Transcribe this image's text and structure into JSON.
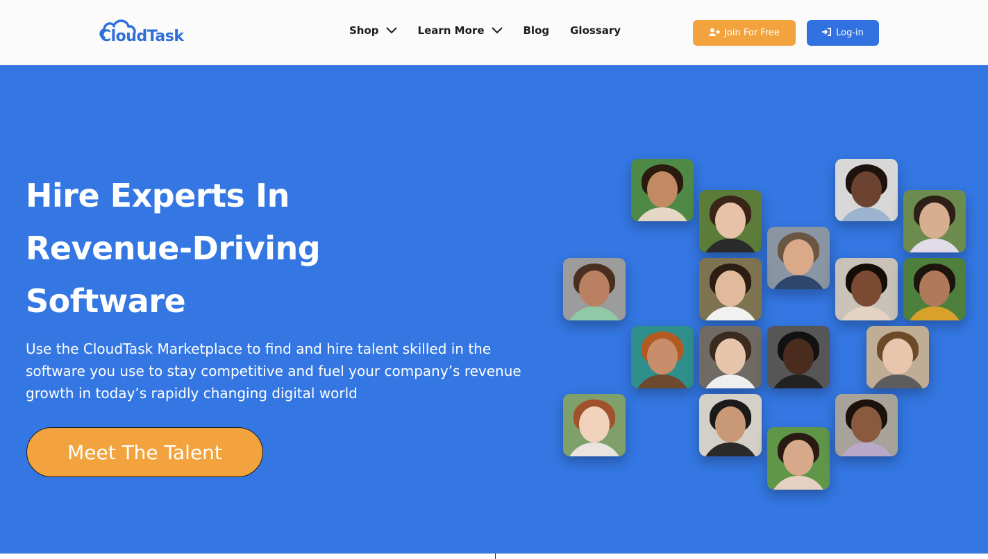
{
  "brand": {
    "logo_text": "CloudTask",
    "color": "#2f6fd8"
  },
  "nav": {
    "items": [
      {
        "label": "Shop",
        "has_dropdown": true
      },
      {
        "label": "Learn More",
        "has_dropdown": true
      },
      {
        "label": "Blog",
        "has_dropdown": false
      },
      {
        "label": "Glossary",
        "has_dropdown": false
      }
    ]
  },
  "header_buttons": {
    "join_label": "Join For Free",
    "join_icon": "user-plus-icon",
    "login_label": "Log-in",
    "login_icon": "sign-in-icon"
  },
  "hero": {
    "title_lines": [
      "Hire Experts In",
      "Revenue-Driving",
      "Software"
    ],
    "description": "Use the CloudTask Marketplace to find and hire talent skilled in the software you use to stay competitive and fuel your company’s revenue growth in today’s rapidly changing digital world",
    "cta_label": "Meet The Talent",
    "background": "#3477e3"
  },
  "colors": {
    "accent_orange": "#f2a33d",
    "primary_blue": "#3172e0"
  }
}
